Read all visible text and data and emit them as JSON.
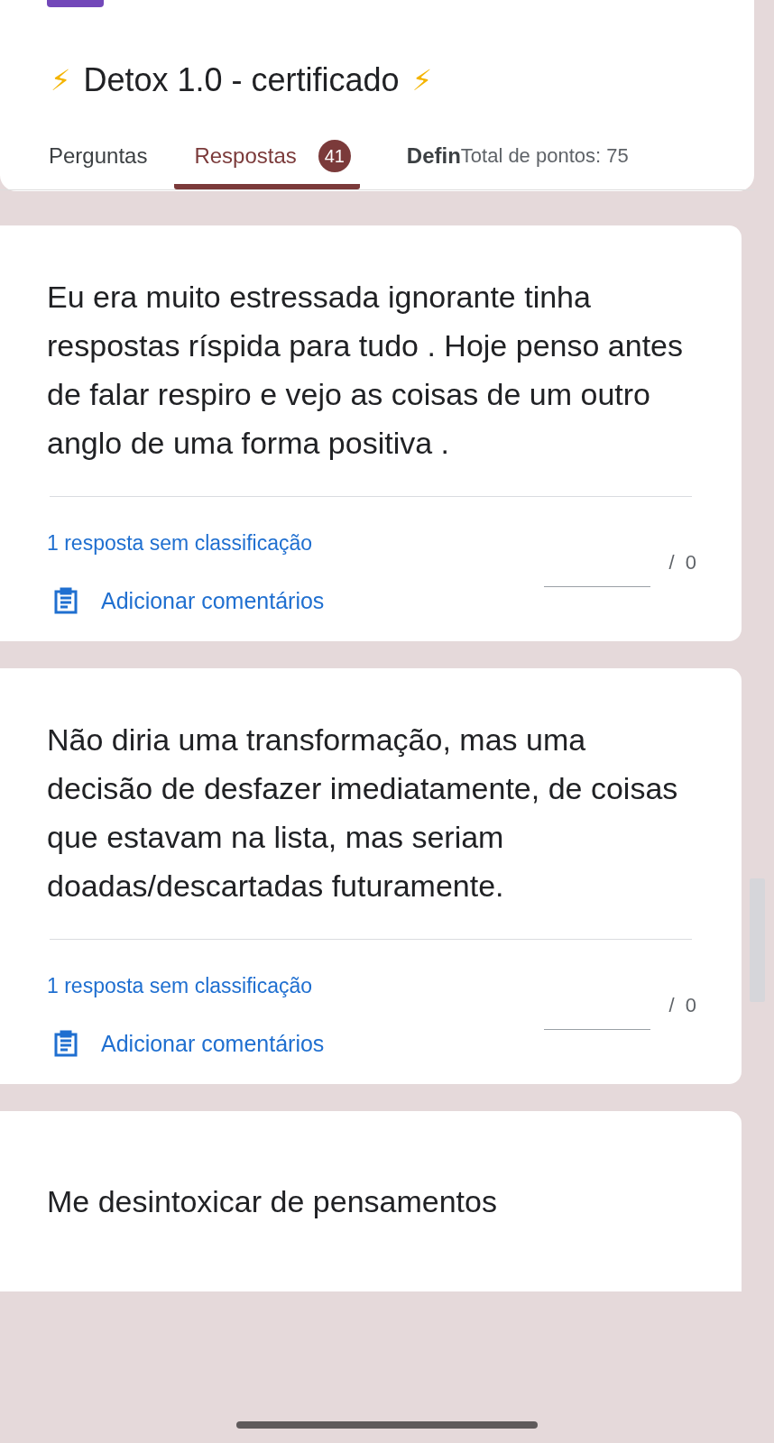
{
  "form": {
    "title": "Detox 1.0 - certificado",
    "title_emoji": "⚡"
  },
  "tabs": [
    {
      "label": "Perguntas",
      "selected": false
    },
    {
      "label": "Respostas",
      "selected": true,
      "badge": "41"
    },
    {
      "label": "Defin",
      "selected": false
    }
  ],
  "total_points": "Total de pontos: 75",
  "answers": [
    {
      "text": "Eu era muito estressada ignorante tinha respostas ríspida para tudo . Hoje penso antes de falar respiro e vejo as coisas de um outro anglo de uma forma positiva .",
      "status": "1 resposta sem classificação",
      "max_score": "/  0",
      "comment_link": "Adicionar comentários"
    },
    {
      "text": "Não diria uma transformação, mas uma decisão de desfazer imediatamente, de coisas que estavam na lista, mas seriam doadas/descartadas futuramente.",
      "status": "1 resposta sem classificação",
      "max_score": "/  0",
      "comment_link": "Adicionar comentários"
    },
    {
      "text": "Me desintoxicar de pensamentos"
    }
  ]
}
